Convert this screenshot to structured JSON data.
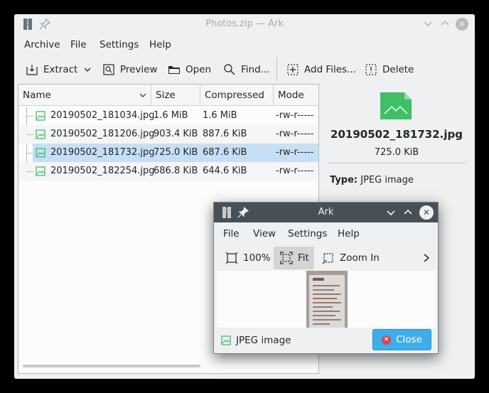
{
  "main_window": {
    "title": "Photos.zip — Ark",
    "menu": [
      "Archive",
      "File",
      "Settings",
      "Help"
    ],
    "toolbar": {
      "extract": "Extract",
      "preview": "Preview",
      "open": "Open",
      "find": "Find...",
      "add_files": "Add Files...",
      "delete": "Delete"
    },
    "columns": [
      "Name",
      "Size",
      "Compressed",
      "Mode"
    ],
    "files": [
      {
        "name": "20190502_181034.jpg",
        "size": "1.6 MiB",
        "compressed": "1.6 MiB",
        "mode": "-rw-r-----"
      },
      {
        "name": "20190502_181206.jpg",
        "size": "903.4 KiB",
        "compressed": "887.6 KiB",
        "mode": "-rw-r-----"
      },
      {
        "name": "20190502_181732.jpg",
        "size": "725.0 KiB",
        "compressed": "687.6 KiB",
        "mode": "-rw-r-----"
      },
      {
        "name": "20190502_182254.jpg",
        "size": "686.8 KiB",
        "compressed": "644.6 KiB",
        "mode": "-rw-r-----"
      }
    ],
    "selected_index": 2,
    "info_panel": {
      "file_name": "20190502_181732.jpg",
      "file_size": "725.0 KiB",
      "type_label": "Type:",
      "type_value": "JPEG image",
      "icon": "image-file-icon"
    }
  },
  "preview_dialog": {
    "title": "Ark",
    "menu": [
      "File",
      "View",
      "Settings",
      "Help"
    ],
    "tools": {
      "zoom_100": "100%",
      "fit": "Fit",
      "zoom_in": "Zoom In"
    },
    "file_type": "JPEG image",
    "close_label": "Close"
  },
  "colors": {
    "accent": "#3daee9",
    "selection": "#c6dff5",
    "dialog_titlebar": "#475057",
    "image_icon": "#3fbf66",
    "close_icon": "#da4453"
  }
}
